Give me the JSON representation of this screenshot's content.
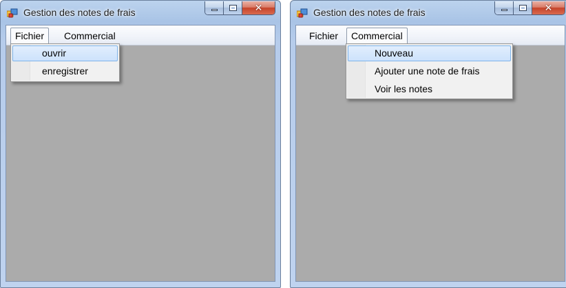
{
  "windows": [
    {
      "title": "Gestion des notes de frais",
      "menu": [
        "Fichier",
        "Commercial"
      ],
      "open_menu": "Fichier",
      "dropdown_items": [
        "ouvrir",
        "enregistrer"
      ],
      "highlighted_item": "ouvrir"
    },
    {
      "title": "Gestion des notes de frais",
      "menu": [
        "Fichier",
        "Commercial"
      ],
      "open_menu": "Commercial",
      "dropdown_items": [
        "Nouveau",
        "Ajouter une note de frais",
        "Voir les notes"
      ],
      "highlighted_item": "Nouveau"
    }
  ],
  "icons": {
    "app": "forms-app-icon",
    "minimize": "minimize-icon",
    "maximize": "maximize-icon",
    "close": "close-icon"
  },
  "colors": {
    "client_background": "#ababab",
    "highlight_border": "#7eb4ea",
    "close_button": "#c5432a"
  }
}
